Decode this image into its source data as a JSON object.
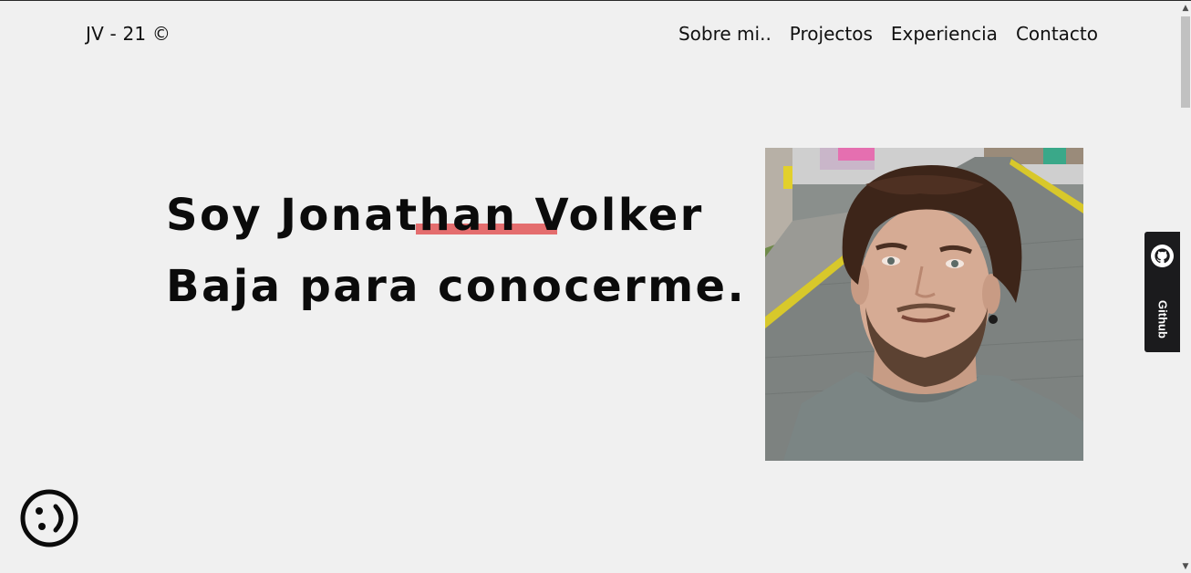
{
  "header": {
    "logo": "JV - 21 ©",
    "nav": [
      {
        "label": "Sobre mi.."
      },
      {
        "label": "Projectos"
      },
      {
        "label": "Experiencia"
      },
      {
        "label": "Contacto"
      }
    ]
  },
  "hero": {
    "line1": "Soy Jonathan Volker",
    "line2": "Baja para conocerme.",
    "accent_color": "#e46d6e"
  },
  "photo": {
    "icon": "profile-photo"
  },
  "github_tab": {
    "label": "Github",
    "icon": "github-icon"
  },
  "floating_button": {
    "icon": "smiley-icon"
  }
}
